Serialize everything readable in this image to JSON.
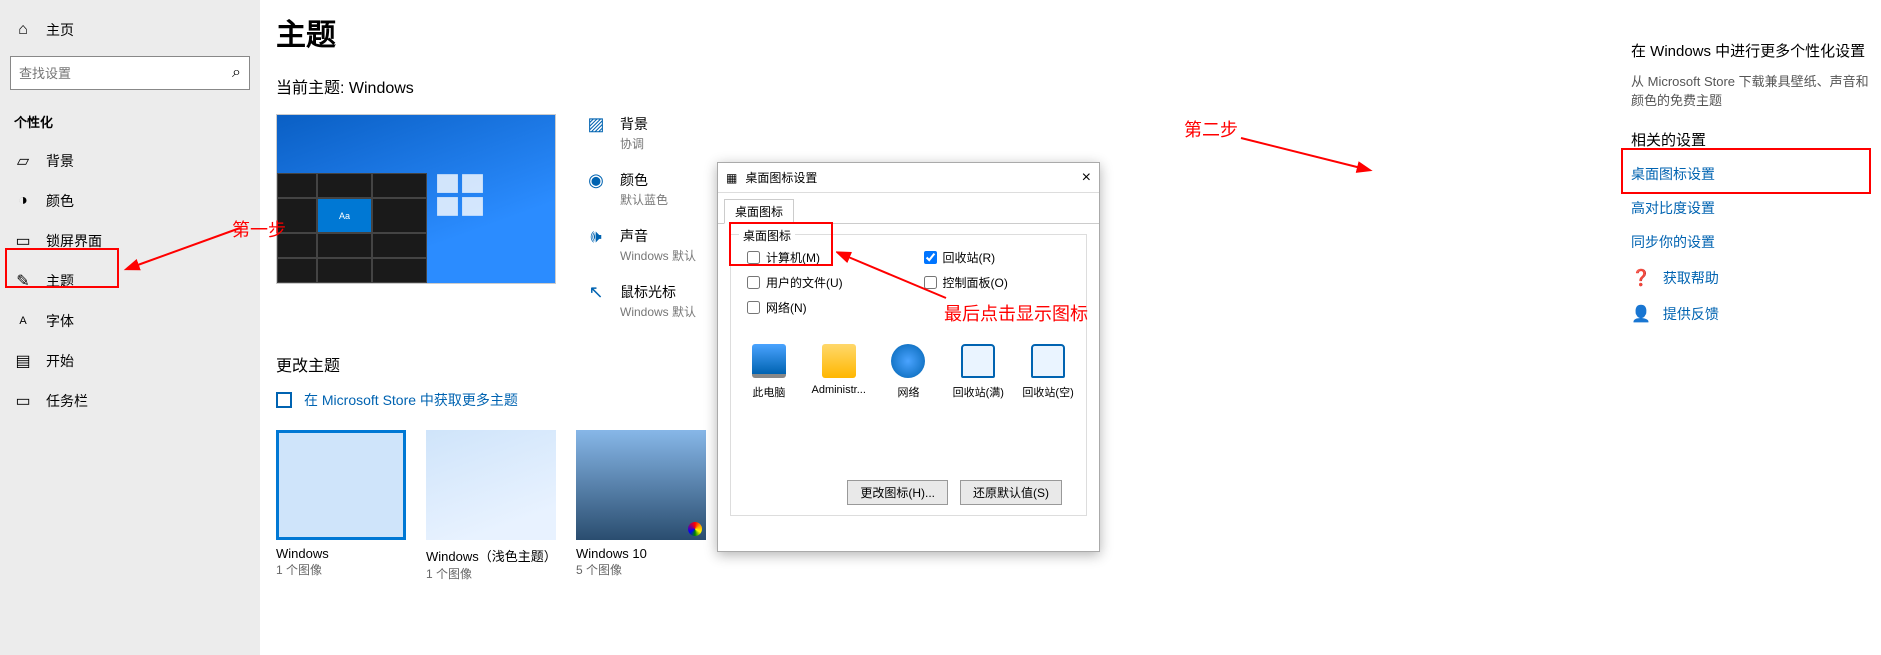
{
  "sidebar": {
    "home": "主页",
    "search_placeholder": "查找设置",
    "category": "个性化",
    "items": [
      {
        "label": "背景"
      },
      {
        "label": "颜色"
      },
      {
        "label": "锁屏界面"
      },
      {
        "label": "主题"
      },
      {
        "label": "字体"
      },
      {
        "label": "开始"
      },
      {
        "label": "任务栏"
      }
    ]
  },
  "main": {
    "title": "主题",
    "current_label": "当前主题: Windows",
    "props": {
      "bg": {
        "t": "背景",
        "s": "协调"
      },
      "color": {
        "t": "颜色",
        "s": "默认蓝色"
      },
      "sound": {
        "t": "声音",
        "s": "Windows 默认"
      },
      "cursor": {
        "t": "鼠标光标",
        "s": "Windows 默认"
      }
    },
    "change_heading": "更改主题",
    "store_link": "在 Microsoft Store 中获取更多主题",
    "themes": [
      {
        "name": "Windows",
        "sub": "1 个图像"
      },
      {
        "name": "Windows（浅色主题）",
        "sub": "1 个图像"
      },
      {
        "name": "Windows 10",
        "sub": "5 个图像"
      }
    ]
  },
  "right": {
    "heading1": "在 Windows 中进行更多个性化设置",
    "desc1": "从 Microsoft Store 下载兼具壁纸、声音和颜色的免费主题",
    "heading2": "相关的设置",
    "links": [
      "桌面图标设置",
      "高对比度设置",
      "同步你的设置"
    ],
    "help": "获取帮助",
    "feedback": "提供反馈"
  },
  "dialog": {
    "title": "桌面图标设置",
    "tab": "桌面图标",
    "group": "桌面图标",
    "checks": {
      "computer": "计算机(M)",
      "recycle": "回收站(R)",
      "user": "用户的文件(U)",
      "control": "控制面板(O)",
      "network": "网络(N)"
    },
    "icons": [
      "此电脑",
      "Administr...",
      "网络",
      "回收站(满)",
      "回收站(空)"
    ],
    "change_btn": "更改图标(H)...",
    "restore_btn": "还原默认值(S)"
  },
  "anno": {
    "step1": "第一步",
    "step2": "第二步",
    "final": "最后点击显示图标"
  }
}
